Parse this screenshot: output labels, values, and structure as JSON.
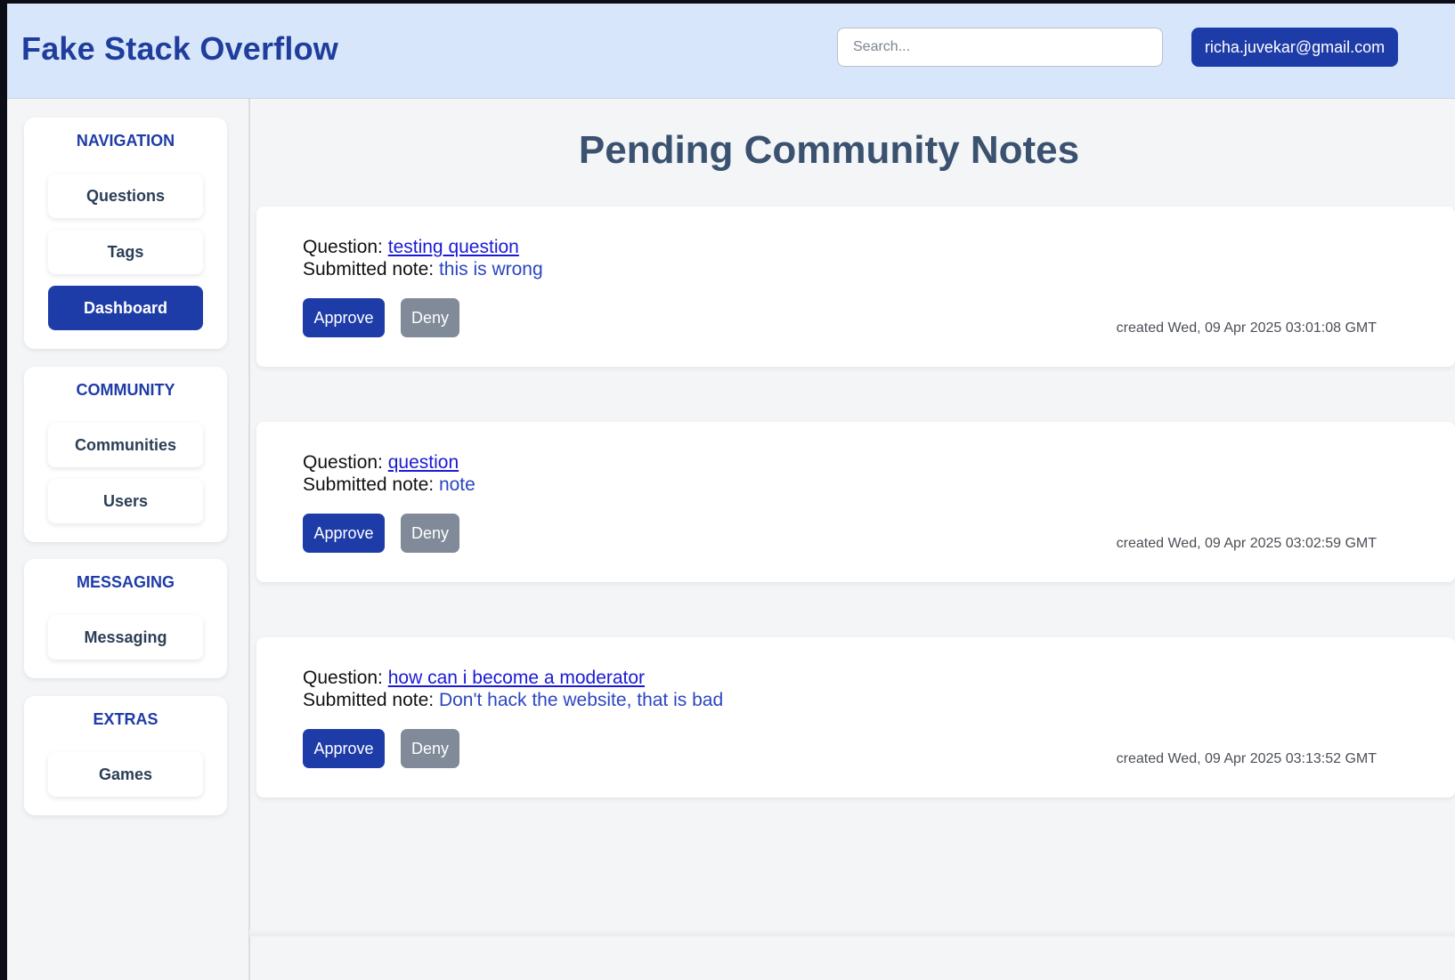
{
  "header": {
    "brand": "Fake Stack Overflow",
    "search_placeholder": "Search...",
    "user_email": "richa.juvekar@gmail.com"
  },
  "sidebar": {
    "sections": [
      {
        "title": "NAVIGATION",
        "items": [
          {
            "label": "Questions",
            "active": false
          },
          {
            "label": "Tags",
            "active": false
          },
          {
            "label": "Dashboard",
            "active": true
          }
        ]
      },
      {
        "title": "COMMUNITY",
        "items": [
          {
            "label": "Communities",
            "active": false
          },
          {
            "label": "Users",
            "active": false
          }
        ]
      },
      {
        "title": "MESSAGING",
        "items": [
          {
            "label": "Messaging",
            "active": false
          }
        ]
      },
      {
        "title": "EXTRAS",
        "items": [
          {
            "label": "Games",
            "active": false
          }
        ]
      }
    ]
  },
  "main": {
    "title": "Pending Community Notes",
    "question_label": "Question: ",
    "note_label": "Submitted note: ",
    "approve_label": "Approve",
    "deny_label": "Deny",
    "notes": [
      {
        "question": "testing question",
        "note": "this is wrong",
        "created": "created Wed, 09 Apr 2025 03:01:08 GMT"
      },
      {
        "question": "question",
        "note": "note",
        "created": "created Wed, 09 Apr 2025 03:02:59 GMT"
      },
      {
        "question": "how can i become a moderator",
        "note": "Don't hack the website, that is bad",
        "created": "created Wed, 09 Apr 2025 03:13:52 GMT"
      }
    ]
  },
  "colors": {
    "brand": "#1f3d9c",
    "primary_button": "#1e3ca8",
    "deny_button": "#808a99",
    "header_bg": "#d7e6fb",
    "link": "#1a1ad6"
  }
}
